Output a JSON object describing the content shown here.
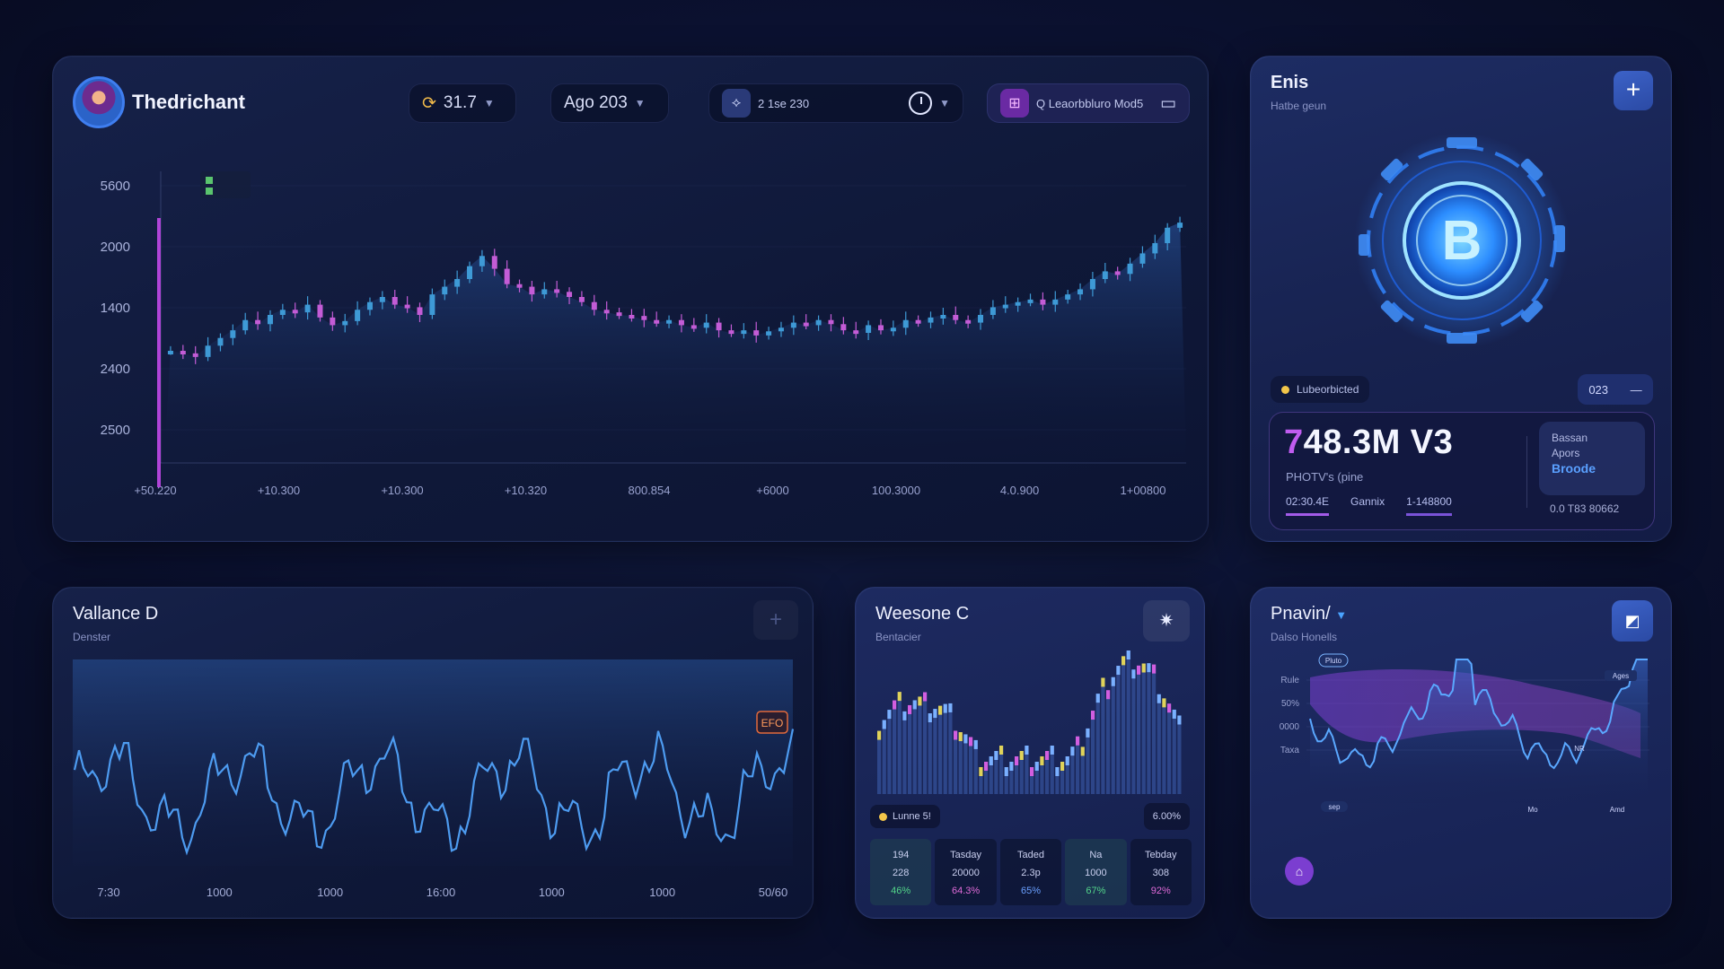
{
  "header": {
    "brand": "Thedrichant",
    "pill_a": "31.7",
    "pill_b": "Ago 203",
    "pill_c": "2 1se 230",
    "pill_d": "Q Leaorbbluro Mod5"
  },
  "main_chart": {
    "y_ticks": [
      "5600",
      "2000",
      "1400",
      "2400",
      "2500"
    ],
    "x_ticks": [
      "+50.220",
      "+10.300",
      "+10.300",
      "+10.320",
      "800.854",
      "+6000",
      "100.3000",
      "4.0.900",
      "1+00800"
    ]
  },
  "coin_panel": {
    "title": "Enis",
    "subtitle": "Hatbe geun",
    "plus_label": "+",
    "status_label": "Lubeorbicted",
    "ctrl_value": "023",
    "ctrl_minus": "—",
    "big_value_accent": "7",
    "big_value_rest": "48.3M V3",
    "value_sub": "PHOTV's (pine",
    "tabs": [
      "02:30.4E",
      "Gannix",
      "1-148800"
    ],
    "side_lines": [
      "Bassan",
      "Apors"
    ],
    "side_highlight": "Broode",
    "foot_value": "0.0 T83 80662"
  },
  "panel_bl": {
    "title": "Vallance D",
    "subtitle": "Denster",
    "corner": "+",
    "badge": "EFO",
    "x_ticks": [
      "7:30",
      "1000",
      "1000",
      "16:00",
      "1000",
      "1000",
      "50/60"
    ]
  },
  "panel_bm": {
    "title": "Weesone C",
    "subtitle": "Bentacier",
    "legend": "Lunne 5!",
    "pct": "6.00%",
    "stats": [
      {
        "head": "194",
        "val": "228",
        "pct": "46%"
      },
      {
        "head": "Tasday",
        "val": "20000",
        "pct": "64.3%"
      },
      {
        "head": "Taded",
        "val": "2.3p",
        "pct": "65%"
      },
      {
        "head": "Na",
        "val": "1000",
        "pct": "67%"
      },
      {
        "head": "Tebday",
        "val": "308",
        "pct": "92%"
      }
    ]
  },
  "panel_br": {
    "title": "Pnavin/",
    "subtitle": "Dalso Honells",
    "y_ticks": [
      "Rule",
      "50%",
      "0000",
      "Taxa"
    ],
    "chips": [
      "Pluto",
      "sep",
      "Ages",
      "NR",
      "Mo",
      "Amd"
    ]
  },
  "colors": {
    "accent_purple": "#c05cf0",
    "accent_blue": "#4aa3ff",
    "up_candle": "#3e9ad6",
    "down_candle": "#c35cd6"
  },
  "chart_data": {
    "type": "candlestick",
    "ylim": [
      0,
      5600
    ],
    "series": [
      {
        "values": [
          2100,
          2050,
          1980,
          2200,
          2350,
          2500,
          2700,
          2620,
          2800,
          2900,
          2850,
          3000,
          2750,
          2600,
          2680,
          2900,
          3050,
          3150,
          3000,
          2950,
          2800,
          3200,
          3350,
          3500,
          3750,
          3950,
          3700,
          3400,
          3350,
          3200,
          3300,
          3250,
          3150,
          3050,
          2900,
          2850,
          2800,
          2780,
          2700,
          2650,
          2700,
          2600,
          2550,
          2650,
          2500,
          2450,
          2500,
          2400,
          2480,
          2550,
          2650,
          2600,
          2700,
          2620,
          2500,
          2450,
          2600,
          2500,
          2550,
          2700,
          2650,
          2750,
          2800,
          2700,
          2650,
          2800,
          2950,
          3000,
          3050,
          3100,
          3000,
          3100,
          3200,
          3300,
          3500,
          3650,
          3600,
          3800,
          4000,
          4200,
          4500,
          4600
        ]
      }
    ]
  }
}
